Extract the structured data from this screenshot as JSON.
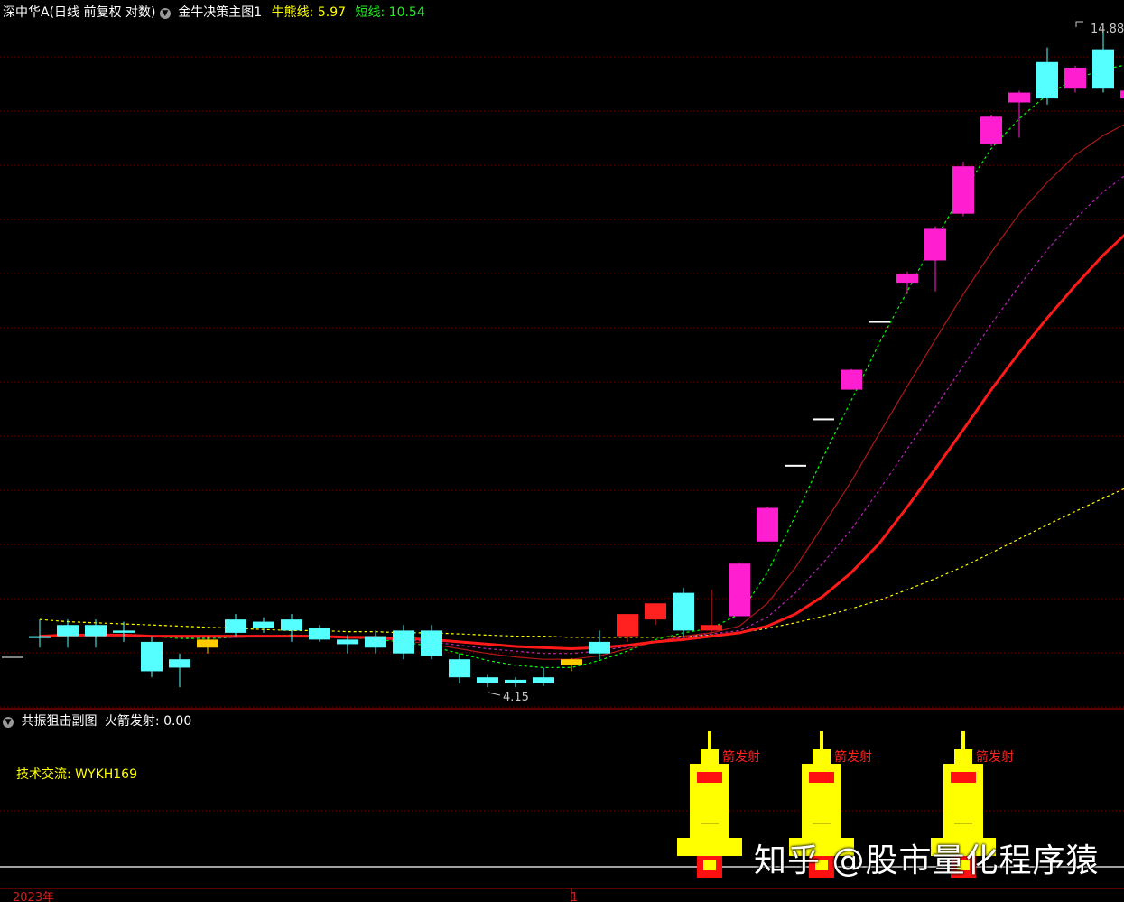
{
  "header": {
    "stock": "深中华A(日线 前复权 对数)",
    "indicator": "金牛决策主图1",
    "bull_label": "牛熊线:",
    "bull_value": "5.97",
    "short_label": "短线:",
    "short_value": "10.54"
  },
  "sub_header": {
    "indicator": "共振狙击副图",
    "label": "火箭发射:",
    "value": "0.00"
  },
  "contact": {
    "label": "技术交流:",
    "value": "WYKH169"
  },
  "rocket_label": "箭发射",
  "annotations": {
    "high": "14.88",
    "low": "4.15"
  },
  "timeline": {
    "year": "2023年",
    "month": "1"
  },
  "watermark": "知乎 @股市量化程序猿",
  "icons": [
    "chevron-down-icon",
    "rocket-icon"
  ],
  "colors": {
    "background": "#000000",
    "up_candle": "#ff1fd0",
    "down_candle": "#55ffff",
    "red_candle": "#ff2020",
    "yellow_candle": "#ffcc00",
    "bull_line": "#ffff00",
    "short_line": "#00ff00",
    "grid": "#7a0000"
  },
  "chart_data": {
    "type": "candlestick",
    "candles": [
      {
        "o": 4.55,
        "h": 4.7,
        "l": 4.45,
        "c": 4.55,
        "k": "cyan"
      },
      {
        "o": 4.65,
        "h": 4.7,
        "l": 4.45,
        "c": 4.55,
        "k": "cyan"
      },
      {
        "o": 4.65,
        "h": 4.7,
        "l": 4.45,
        "c": 4.55,
        "k": "cyan"
      },
      {
        "o": 4.6,
        "h": 4.68,
        "l": 4.5,
        "c": 4.58,
        "k": "cyan"
      },
      {
        "o": 4.5,
        "h": 4.55,
        "l": 4.2,
        "c": 4.25,
        "k": "cyan"
      },
      {
        "o": 4.35,
        "h": 4.4,
        "l": 4.12,
        "c": 4.28,
        "k": "cyan"
      },
      {
        "o": 4.45,
        "h": 4.55,
        "l": 4.4,
        "c": 4.52,
        "k": "yellow"
      },
      {
        "o": 4.7,
        "h": 4.75,
        "l": 4.55,
        "c": 4.58,
        "k": "cyan"
      },
      {
        "o": 4.68,
        "h": 4.72,
        "l": 4.58,
        "c": 4.62,
        "k": "cyan"
      },
      {
        "o": 4.7,
        "h": 4.75,
        "l": 4.5,
        "c": 4.6,
        "k": "cyan"
      },
      {
        "o": 4.62,
        "h": 4.65,
        "l": 4.5,
        "c": 4.52,
        "k": "cyan"
      },
      {
        "o": 4.52,
        "h": 4.56,
        "l": 4.4,
        "c": 4.48,
        "k": "cyan"
      },
      {
        "o": 4.55,
        "h": 4.6,
        "l": 4.4,
        "c": 4.45,
        "k": "cyan"
      },
      {
        "o": 4.6,
        "h": 4.65,
        "l": 4.35,
        "c": 4.4,
        "k": "cyan"
      },
      {
        "o": 4.6,
        "h": 4.65,
        "l": 4.35,
        "c": 4.38,
        "k": "cyan"
      },
      {
        "o": 4.35,
        "h": 4.4,
        "l": 4.15,
        "c": 4.2,
        "k": "cyan"
      },
      {
        "o": 4.2,
        "h": 4.22,
        "l": 4.12,
        "c": 4.15,
        "k": "cyan"
      },
      {
        "o": 4.18,
        "h": 4.2,
        "l": 4.12,
        "c": 4.15,
        "k": "cyan"
      },
      {
        "o": 4.2,
        "h": 4.28,
        "l": 4.13,
        "c": 4.15,
        "k": "cyan"
      },
      {
        "o": 4.3,
        "h": 4.36,
        "l": 4.25,
        "c": 4.35,
        "k": "yellow"
      },
      {
        "o": 4.5,
        "h": 4.6,
        "l": 4.35,
        "c": 4.4,
        "k": "cyan"
      },
      {
        "o": 4.55,
        "h": 4.75,
        "l": 4.5,
        "c": 4.75,
        "k": "red"
      },
      {
        "o": 4.7,
        "h": 4.82,
        "l": 4.65,
        "c": 4.85,
        "k": "red"
      },
      {
        "o": 4.95,
        "h": 5.0,
        "l": 4.55,
        "c": 4.6,
        "k": "cyan"
      },
      {
        "o": 4.6,
        "h": 4.98,
        "l": 4.58,
        "c": 4.65,
        "k": "red"
      },
      {
        "o": 4.73,
        "h": 5.25,
        "l": 4.73,
        "c": 5.24,
        "k": "pink"
      },
      {
        "o": 5.47,
        "h": 5.85,
        "l": 5.47,
        "c": 5.84,
        "k": "pink"
      },
      {
        "o": 6.35,
        "h": 6.35,
        "l": 6.35,
        "c": 6.35,
        "k": "flat"
      },
      {
        "o": 6.95,
        "h": 6.95,
        "l": 6.95,
        "c": 6.95,
        "k": "flat"
      },
      {
        "o": 7.35,
        "h": 7.65,
        "l": 7.35,
        "c": 7.64,
        "k": "pink"
      },
      {
        "o": 8.4,
        "h": 8.4,
        "l": 8.4,
        "c": 8.4,
        "k": "flat"
      },
      {
        "o": 9.05,
        "h": 9.25,
        "l": 8.85,
        "c": 9.2,
        "k": "pink"
      },
      {
        "o": 9.45,
        "h": 10.1,
        "l": 8.9,
        "c": 10.05,
        "k": "pink"
      },
      {
        "o": 10.35,
        "h": 11.45,
        "l": 10.3,
        "c": 11.35,
        "k": "pink"
      },
      {
        "o": 11.85,
        "h": 12.55,
        "l": 11.8,
        "c": 12.5,
        "k": "pink"
      },
      {
        "o": 12.85,
        "h": 13.15,
        "l": 12.0,
        "c": 13.1,
        "k": "pink"
      },
      {
        "o": 13.9,
        "h": 14.3,
        "l": 12.8,
        "c": 12.95,
        "k": "cyan"
      },
      {
        "o": 13.2,
        "h": 13.8,
        "l": 13.1,
        "c": 13.75,
        "k": "pink"
      },
      {
        "o": 14.25,
        "h": 14.88,
        "l": 13.1,
        "c": 13.2,
        "k": "cyan"
      },
      {
        "o": 12.95,
        "h": 13.5,
        "l": 12.5,
        "c": 13.15,
        "k": "pink"
      },
      {
        "o": 13.2,
        "h": 13.4,
        "l": 12.9,
        "c": 13.35,
        "k": "pink"
      }
    ],
    "lines": [
      {
        "name": "bull",
        "color": "#ffff00",
        "dash": "3,3",
        "v": [
          4.7,
          4.68,
          4.67,
          4.66,
          4.65,
          4.64,
          4.63,
          4.62,
          4.61,
          4.6,
          4.6,
          4.59,
          4.59,
          4.58,
          4.58,
          4.57,
          4.56,
          4.55,
          4.55,
          4.54,
          4.54,
          4.54,
          4.54,
          4.55,
          4.56,
          4.58,
          4.62,
          4.67,
          4.73,
          4.8,
          4.88,
          4.98,
          5.09,
          5.21,
          5.35,
          5.5,
          5.65,
          5.8,
          5.95,
          6.1,
          6.25
        ]
      },
      {
        "name": "short",
        "color": "#00ff00",
        "dash": "3,3",
        "v": [
          4.55,
          4.56,
          4.56,
          4.56,
          4.55,
          4.53,
          4.53,
          4.54,
          4.55,
          4.56,
          4.55,
          4.54,
          4.52,
          4.5,
          4.46,
          4.4,
          4.34,
          4.3,
          4.28,
          4.28,
          4.34,
          4.42,
          4.52,
          4.58,
          4.62,
          4.75,
          5.15,
          5.75,
          6.45,
          7.2,
          8.05,
          8.9,
          9.85,
          10.8,
          11.75,
          12.45,
          13.05,
          13.45,
          13.7,
          13.85,
          13.9
        ]
      },
      {
        "name": "mid",
        "color": "#b01818",
        "dash": "",
        "v": [
          4.55,
          4.56,
          4.56,
          4.56,
          4.55,
          4.54,
          4.54,
          4.54,
          4.55,
          4.55,
          4.55,
          4.54,
          4.53,
          4.51,
          4.48,
          4.44,
          4.4,
          4.37,
          4.35,
          4.35,
          4.38,
          4.44,
          4.5,
          4.55,
          4.58,
          4.64,
          4.85,
          5.2,
          5.65,
          6.15,
          6.75,
          7.4,
          8.1,
          8.85,
          9.6,
          10.35,
          11.0,
          11.6,
          12.05,
          12.4,
          12.55
        ]
      },
      {
        "name": "purple",
        "color": "#c020c0",
        "dash": "3,3",
        "v": [
          4.55,
          4.56,
          4.56,
          4.56,
          4.55,
          4.54,
          4.54,
          4.54,
          4.55,
          4.55,
          4.55,
          4.54,
          4.53,
          4.52,
          4.5,
          4.47,
          4.44,
          4.42,
          4.4,
          4.4,
          4.42,
          4.46,
          4.5,
          4.54,
          4.57,
          4.6,
          4.72,
          4.95,
          5.25,
          5.6,
          6.05,
          6.55,
          7.1,
          7.7,
          8.35,
          9.0,
          9.65,
          10.25,
          10.8,
          11.25,
          11.55
        ]
      },
      {
        "name": "thick",
        "color": "#ff1a1a",
        "dash": "",
        "w": 3,
        "v": [
          4.55,
          4.56,
          4.56,
          4.56,
          4.55,
          4.55,
          4.55,
          4.55,
          4.55,
          4.55,
          4.55,
          4.54,
          4.54,
          4.53,
          4.52,
          4.5,
          4.48,
          4.46,
          4.45,
          4.44,
          4.45,
          4.47,
          4.5,
          4.52,
          4.55,
          4.58,
          4.64,
          4.75,
          4.92,
          5.15,
          5.45,
          5.85,
          6.3,
          6.8,
          7.35,
          7.9,
          8.45,
          9.0,
          9.55,
          10.05,
          10.5
        ]
      }
    ],
    "y_scale": "log"
  }
}
